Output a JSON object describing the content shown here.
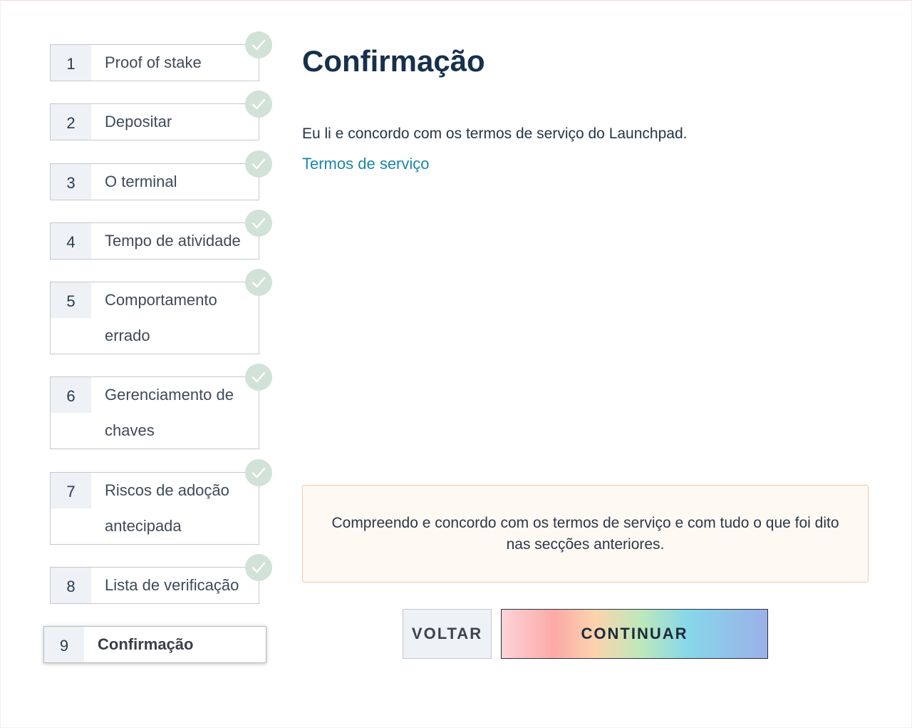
{
  "steps": [
    {
      "number": "1",
      "label": "Proof of stake",
      "completed": true
    },
    {
      "number": "2",
      "label": "Depositar",
      "completed": true
    },
    {
      "number": "3",
      "label": "O terminal",
      "completed": true
    },
    {
      "number": "4",
      "label": "Tempo de atividade",
      "completed": true
    },
    {
      "number": "5",
      "label": "Comportamento errado",
      "completed": true
    },
    {
      "number": "6",
      "label": "Gerenciamento de chaves",
      "completed": true
    },
    {
      "number": "7",
      "label": "Riscos de adoção antecipada",
      "completed": true
    },
    {
      "number": "8",
      "label": "Lista de verificação",
      "completed": true
    },
    {
      "number": "9",
      "label": "Confirmação",
      "completed": false,
      "active": true
    }
  ],
  "main": {
    "title": "Confirmação",
    "agree_text": "Eu li e concordo com os termos de serviço do Launchpad.",
    "tos_link": "Termos de serviço",
    "confirm_text": "Compreendo e concordo com os termos de serviço e com tudo o que foi dito nas secções anteriores."
  },
  "buttons": {
    "back_label": "VOLTAR",
    "continue_label": "CONTINUAR"
  },
  "colors": {
    "check_bg": "#d1e2d7",
    "title": "#17304b",
    "link": "#1b87a8",
    "confirm_bg": "#fff9f4",
    "confirm_border": "#f1caa7"
  }
}
